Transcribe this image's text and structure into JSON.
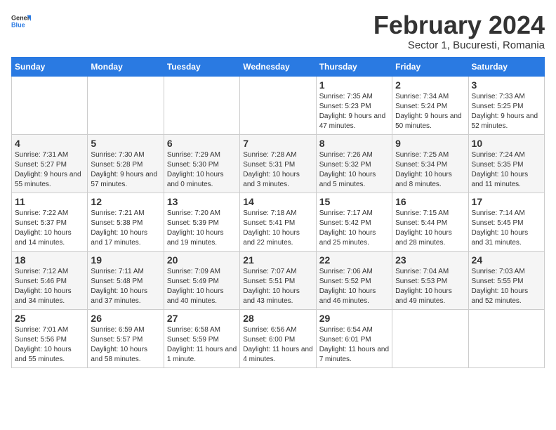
{
  "header": {
    "logo_general": "General",
    "logo_blue": "Blue",
    "title": "February 2024",
    "subtitle": "Sector 1, Bucuresti, Romania"
  },
  "calendar": {
    "days_of_week": [
      "Sunday",
      "Monday",
      "Tuesday",
      "Wednesday",
      "Thursday",
      "Friday",
      "Saturday"
    ],
    "weeks": [
      [
        {
          "day": "",
          "info": ""
        },
        {
          "day": "",
          "info": ""
        },
        {
          "day": "",
          "info": ""
        },
        {
          "day": "",
          "info": ""
        },
        {
          "day": "1",
          "info": "Sunrise: 7:35 AM\nSunset: 5:23 PM\nDaylight: 9 hours and 47 minutes."
        },
        {
          "day": "2",
          "info": "Sunrise: 7:34 AM\nSunset: 5:24 PM\nDaylight: 9 hours and 50 minutes."
        },
        {
          "day": "3",
          "info": "Sunrise: 7:33 AM\nSunset: 5:25 PM\nDaylight: 9 hours and 52 minutes."
        }
      ],
      [
        {
          "day": "4",
          "info": "Sunrise: 7:31 AM\nSunset: 5:27 PM\nDaylight: 9 hours and 55 minutes."
        },
        {
          "day": "5",
          "info": "Sunrise: 7:30 AM\nSunset: 5:28 PM\nDaylight: 9 hours and 57 minutes."
        },
        {
          "day": "6",
          "info": "Sunrise: 7:29 AM\nSunset: 5:30 PM\nDaylight: 10 hours and 0 minutes."
        },
        {
          "day": "7",
          "info": "Sunrise: 7:28 AM\nSunset: 5:31 PM\nDaylight: 10 hours and 3 minutes."
        },
        {
          "day": "8",
          "info": "Sunrise: 7:26 AM\nSunset: 5:32 PM\nDaylight: 10 hours and 5 minutes."
        },
        {
          "day": "9",
          "info": "Sunrise: 7:25 AM\nSunset: 5:34 PM\nDaylight: 10 hours and 8 minutes."
        },
        {
          "day": "10",
          "info": "Sunrise: 7:24 AM\nSunset: 5:35 PM\nDaylight: 10 hours and 11 minutes."
        }
      ],
      [
        {
          "day": "11",
          "info": "Sunrise: 7:22 AM\nSunset: 5:37 PM\nDaylight: 10 hours and 14 minutes."
        },
        {
          "day": "12",
          "info": "Sunrise: 7:21 AM\nSunset: 5:38 PM\nDaylight: 10 hours and 17 minutes."
        },
        {
          "day": "13",
          "info": "Sunrise: 7:20 AM\nSunset: 5:39 PM\nDaylight: 10 hours and 19 minutes."
        },
        {
          "day": "14",
          "info": "Sunrise: 7:18 AM\nSunset: 5:41 PM\nDaylight: 10 hours and 22 minutes."
        },
        {
          "day": "15",
          "info": "Sunrise: 7:17 AM\nSunset: 5:42 PM\nDaylight: 10 hours and 25 minutes."
        },
        {
          "day": "16",
          "info": "Sunrise: 7:15 AM\nSunset: 5:44 PM\nDaylight: 10 hours and 28 minutes."
        },
        {
          "day": "17",
          "info": "Sunrise: 7:14 AM\nSunset: 5:45 PM\nDaylight: 10 hours and 31 minutes."
        }
      ],
      [
        {
          "day": "18",
          "info": "Sunrise: 7:12 AM\nSunset: 5:46 PM\nDaylight: 10 hours and 34 minutes."
        },
        {
          "day": "19",
          "info": "Sunrise: 7:11 AM\nSunset: 5:48 PM\nDaylight: 10 hours and 37 minutes."
        },
        {
          "day": "20",
          "info": "Sunrise: 7:09 AM\nSunset: 5:49 PM\nDaylight: 10 hours and 40 minutes."
        },
        {
          "day": "21",
          "info": "Sunrise: 7:07 AM\nSunset: 5:51 PM\nDaylight: 10 hours and 43 minutes."
        },
        {
          "day": "22",
          "info": "Sunrise: 7:06 AM\nSunset: 5:52 PM\nDaylight: 10 hours and 46 minutes."
        },
        {
          "day": "23",
          "info": "Sunrise: 7:04 AM\nSunset: 5:53 PM\nDaylight: 10 hours and 49 minutes."
        },
        {
          "day": "24",
          "info": "Sunrise: 7:03 AM\nSunset: 5:55 PM\nDaylight: 10 hours and 52 minutes."
        }
      ],
      [
        {
          "day": "25",
          "info": "Sunrise: 7:01 AM\nSunset: 5:56 PM\nDaylight: 10 hours and 55 minutes."
        },
        {
          "day": "26",
          "info": "Sunrise: 6:59 AM\nSunset: 5:57 PM\nDaylight: 10 hours and 58 minutes."
        },
        {
          "day": "27",
          "info": "Sunrise: 6:58 AM\nSunset: 5:59 PM\nDaylight: 11 hours and 1 minute."
        },
        {
          "day": "28",
          "info": "Sunrise: 6:56 AM\nSunset: 6:00 PM\nDaylight: 11 hours and 4 minutes."
        },
        {
          "day": "29",
          "info": "Sunrise: 6:54 AM\nSunset: 6:01 PM\nDaylight: 11 hours and 7 minutes."
        },
        {
          "day": "",
          "info": ""
        },
        {
          "day": "",
          "info": ""
        }
      ]
    ]
  }
}
